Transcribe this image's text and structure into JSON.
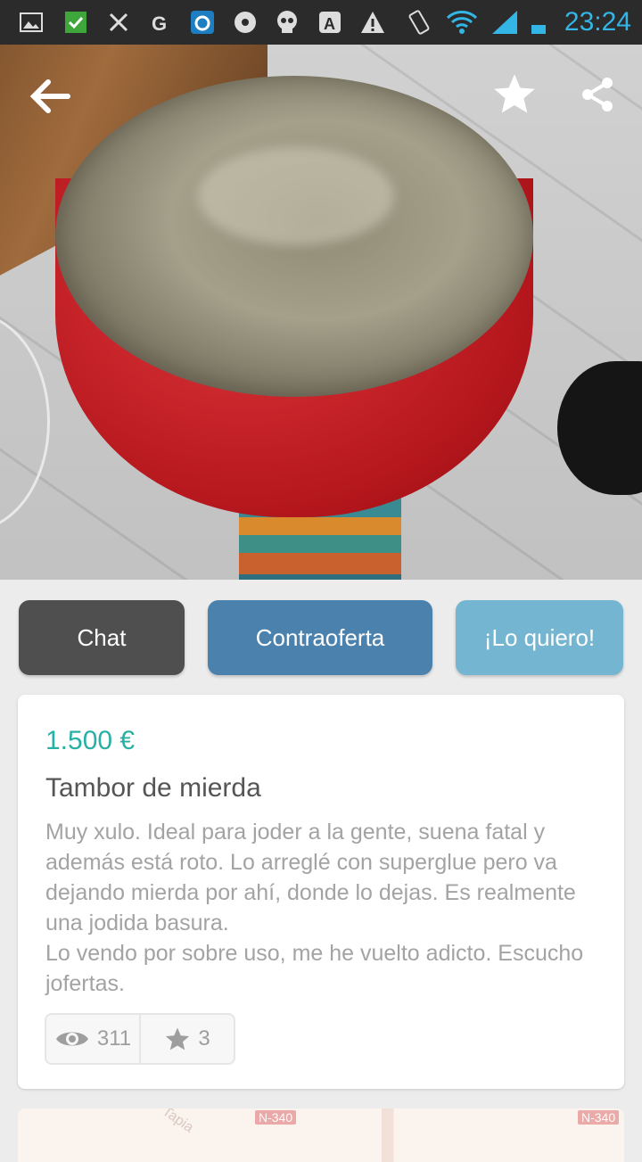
{
  "statusbar": {
    "time": "23:24",
    "icons": [
      "image-icon",
      "check-icon",
      "tools-icon",
      "g-icon",
      "app-icon",
      "soccer-icon",
      "skull-icon",
      "a-icon",
      "warning-icon",
      "rotate-icon",
      "wifi-icon",
      "signal-icon",
      "battery-icon"
    ],
    "time_color": "#33b5e5"
  },
  "hero": {
    "back_icon": "arrow-left-icon",
    "favorite_icon": "star-icon",
    "share_icon": "share-icon",
    "pager_dots": 1
  },
  "actions": {
    "chat": "Chat",
    "counteroffer": "Contraoferta",
    "want": "¡Lo quiero!"
  },
  "listing": {
    "price": "1.500 €",
    "title": "Tambor de mierda",
    "description": "Muy xulo. Ideal para joder a la gente, suena fatal y además está roto. Lo arreglé con superglue pero va dejando mierda por ahí, donde lo dejas. Es realmente una jodida basura.\nLo vendo por sobre uso, me he vuelto adicto. Escucho jofertas.",
    "views": "311",
    "favorites": "3"
  },
  "map": {
    "road_label_1": "N-340",
    "road_label_2": "N-340",
    "street_label": "Tapia"
  },
  "colors": {
    "price": "#27b0a4",
    "chat_button": "#4f4f4f",
    "counteroffer_button": "#4b81ad",
    "want_button": "#74b6d2"
  }
}
